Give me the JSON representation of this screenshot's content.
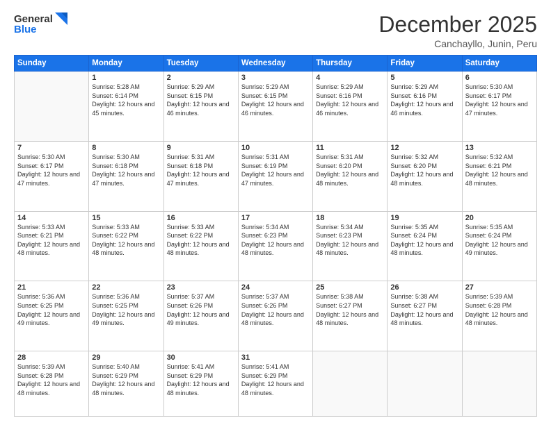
{
  "logo": {
    "line1": "General",
    "line2": "Blue"
  },
  "title": {
    "month": "December 2025",
    "location": "Canchayllo, Junin, Peru"
  },
  "days_of_week": [
    "Sunday",
    "Monday",
    "Tuesday",
    "Wednesday",
    "Thursday",
    "Friday",
    "Saturday"
  ],
  "weeks": [
    [
      {
        "day": "",
        "sunrise": "",
        "sunset": "",
        "daylight": ""
      },
      {
        "day": "1",
        "sunrise": "5:28 AM",
        "sunset": "6:14 PM",
        "daylight": "12 hours and 45 minutes."
      },
      {
        "day": "2",
        "sunrise": "5:29 AM",
        "sunset": "6:15 PM",
        "daylight": "12 hours and 46 minutes."
      },
      {
        "day": "3",
        "sunrise": "5:29 AM",
        "sunset": "6:15 PM",
        "daylight": "12 hours and 46 minutes."
      },
      {
        "day": "4",
        "sunrise": "5:29 AM",
        "sunset": "6:16 PM",
        "daylight": "12 hours and 46 minutes."
      },
      {
        "day": "5",
        "sunrise": "5:29 AM",
        "sunset": "6:16 PM",
        "daylight": "12 hours and 46 minutes."
      },
      {
        "day": "6",
        "sunrise": "5:30 AM",
        "sunset": "6:17 PM",
        "daylight": "12 hours and 47 minutes."
      }
    ],
    [
      {
        "day": "7",
        "sunrise": "5:30 AM",
        "sunset": "6:17 PM",
        "daylight": "12 hours and 47 minutes."
      },
      {
        "day": "8",
        "sunrise": "5:30 AM",
        "sunset": "6:18 PM",
        "daylight": "12 hours and 47 minutes."
      },
      {
        "day": "9",
        "sunrise": "5:31 AM",
        "sunset": "6:18 PM",
        "daylight": "12 hours and 47 minutes."
      },
      {
        "day": "10",
        "sunrise": "5:31 AM",
        "sunset": "6:19 PM",
        "daylight": "12 hours and 47 minutes."
      },
      {
        "day": "11",
        "sunrise": "5:31 AM",
        "sunset": "6:20 PM",
        "daylight": "12 hours and 48 minutes."
      },
      {
        "day": "12",
        "sunrise": "5:32 AM",
        "sunset": "6:20 PM",
        "daylight": "12 hours and 48 minutes."
      },
      {
        "day": "13",
        "sunrise": "5:32 AM",
        "sunset": "6:21 PM",
        "daylight": "12 hours and 48 minutes."
      }
    ],
    [
      {
        "day": "14",
        "sunrise": "5:33 AM",
        "sunset": "6:21 PM",
        "daylight": "12 hours and 48 minutes."
      },
      {
        "day": "15",
        "sunrise": "5:33 AM",
        "sunset": "6:22 PM",
        "daylight": "12 hours and 48 minutes."
      },
      {
        "day": "16",
        "sunrise": "5:33 AM",
        "sunset": "6:22 PM",
        "daylight": "12 hours and 48 minutes."
      },
      {
        "day": "17",
        "sunrise": "5:34 AM",
        "sunset": "6:23 PM",
        "daylight": "12 hours and 48 minutes."
      },
      {
        "day": "18",
        "sunrise": "5:34 AM",
        "sunset": "6:23 PM",
        "daylight": "12 hours and 48 minutes."
      },
      {
        "day": "19",
        "sunrise": "5:35 AM",
        "sunset": "6:24 PM",
        "daylight": "12 hours and 48 minutes."
      },
      {
        "day": "20",
        "sunrise": "5:35 AM",
        "sunset": "6:24 PM",
        "daylight": "12 hours and 49 minutes."
      }
    ],
    [
      {
        "day": "21",
        "sunrise": "5:36 AM",
        "sunset": "6:25 PM",
        "daylight": "12 hours and 49 minutes."
      },
      {
        "day": "22",
        "sunrise": "5:36 AM",
        "sunset": "6:25 PM",
        "daylight": "12 hours and 49 minutes."
      },
      {
        "day": "23",
        "sunrise": "5:37 AM",
        "sunset": "6:26 PM",
        "daylight": "12 hours and 49 minutes."
      },
      {
        "day": "24",
        "sunrise": "5:37 AM",
        "sunset": "6:26 PM",
        "daylight": "12 hours and 48 minutes."
      },
      {
        "day": "25",
        "sunrise": "5:38 AM",
        "sunset": "6:27 PM",
        "daylight": "12 hours and 48 minutes."
      },
      {
        "day": "26",
        "sunrise": "5:38 AM",
        "sunset": "6:27 PM",
        "daylight": "12 hours and 48 minutes."
      },
      {
        "day": "27",
        "sunrise": "5:39 AM",
        "sunset": "6:28 PM",
        "daylight": "12 hours and 48 minutes."
      }
    ],
    [
      {
        "day": "28",
        "sunrise": "5:39 AM",
        "sunset": "6:28 PM",
        "daylight": "12 hours and 48 minutes."
      },
      {
        "day": "29",
        "sunrise": "5:40 AM",
        "sunset": "6:29 PM",
        "daylight": "12 hours and 48 minutes."
      },
      {
        "day": "30",
        "sunrise": "5:41 AM",
        "sunset": "6:29 PM",
        "daylight": "12 hours and 48 minutes."
      },
      {
        "day": "31",
        "sunrise": "5:41 AM",
        "sunset": "6:29 PM",
        "daylight": "12 hours and 48 minutes."
      },
      {
        "day": "",
        "sunrise": "",
        "sunset": "",
        "daylight": ""
      },
      {
        "day": "",
        "sunrise": "",
        "sunset": "",
        "daylight": ""
      },
      {
        "day": "",
        "sunrise": "",
        "sunset": "",
        "daylight": ""
      }
    ]
  ],
  "labels": {
    "sunrise": "Sunrise:",
    "sunset": "Sunset:",
    "daylight": "Daylight:"
  }
}
